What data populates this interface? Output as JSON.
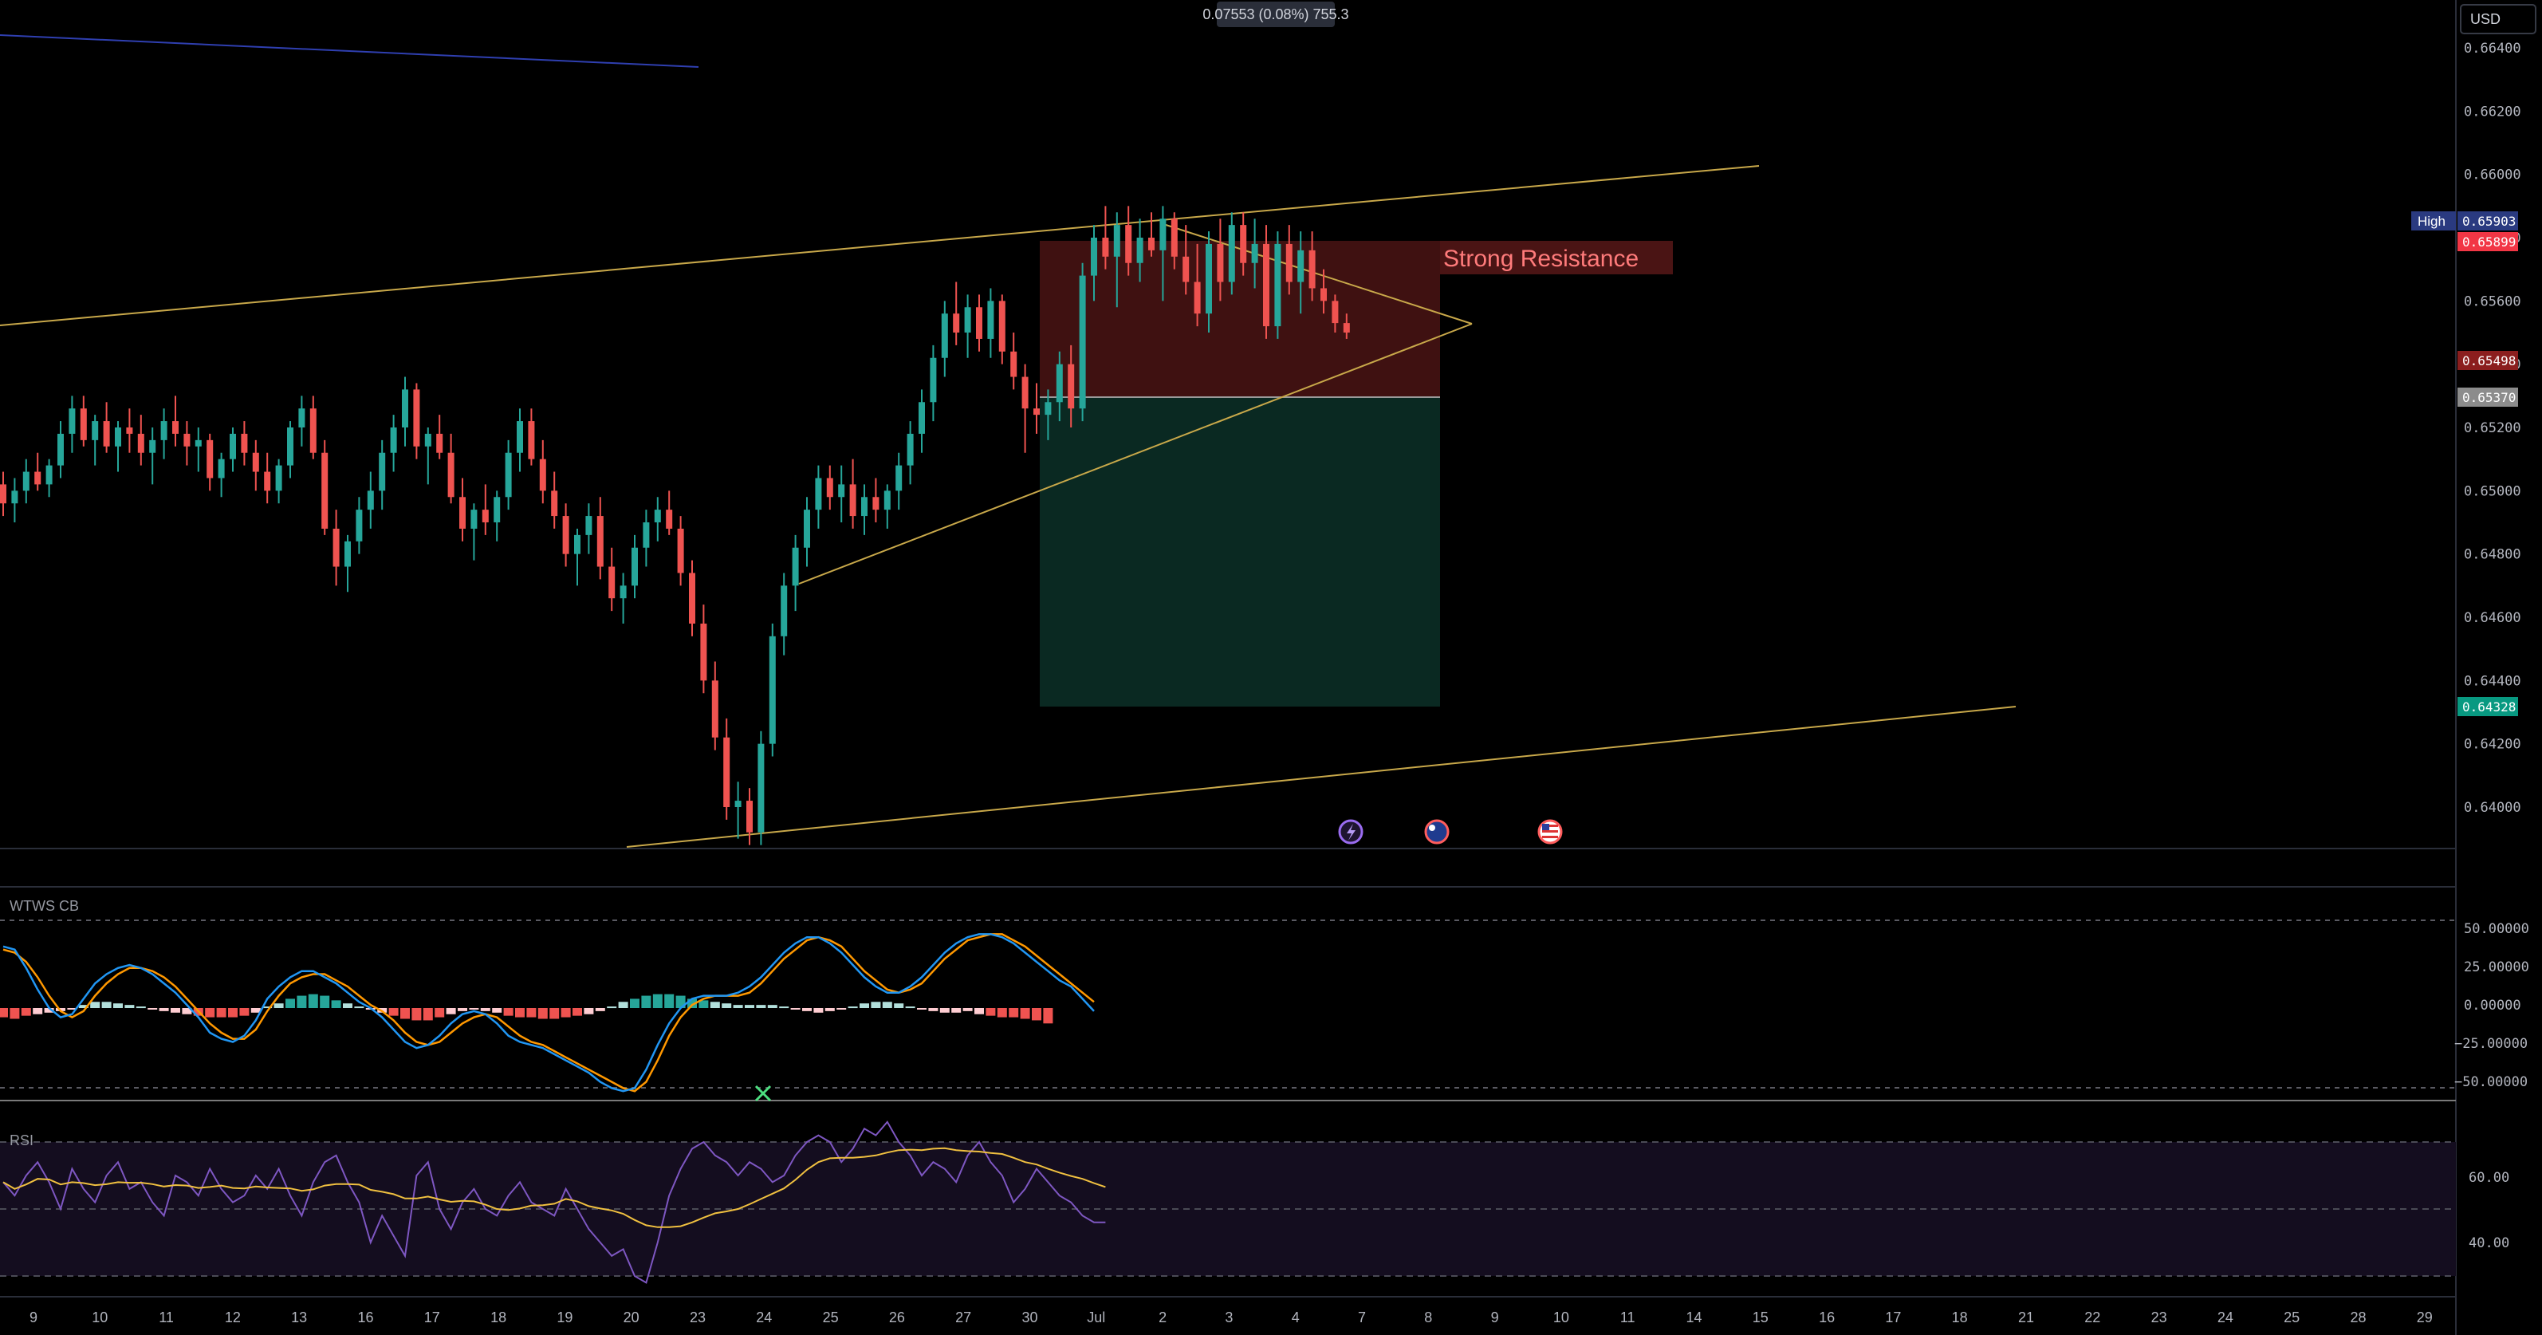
{
  "header": {
    "measure_label": "0.07553 (0.08%) 755.3"
  },
  "currency_button": "USD",
  "colors": {
    "bg": "#000000",
    "up": "#26a69a",
    "down": "#ef5350",
    "trendline": "#c8a84a",
    "blue_line": "#2f3fb0",
    "resistance_zone": "#5a1a1a",
    "target_zone": "#0b2e26",
    "wt1": "#2196f3",
    "wt2": "#ff9800",
    "rsi": "#7e57c2",
    "rsi_ma": "#f0c040",
    "high_badge": "#2a3a80",
    "price_badge": "#f23645",
    "stop_badge": "#8c8c8c",
    "target_badge": "#089981",
    "sell_badge": "#8b1e1e"
  },
  "price_axis": {
    "ticks": [
      "0.66400",
      "0.66200",
      "0.66000",
      "0.65800",
      "0.65600",
      "0.65400",
      "0.65200",
      "0.65000",
      "0.64800",
      "0.64600",
      "0.64400",
      "0.64200",
      "0.64000"
    ],
    "high_label": "High",
    "high_value": "0.65903",
    "current_price": "0.65899",
    "entry_price": "0.65498",
    "stop_price": "0.65370",
    "target_price": "0.64328"
  },
  "annotations": {
    "resistance_text": "Strong Resistance"
  },
  "event_icons": [
    "lightning-icon",
    "australia-flag-icon",
    "us-flag-icon"
  ],
  "wt_panel": {
    "title": "WTWS CB",
    "ticks": [
      "50.00000",
      "25.00000",
      "0.00000",
      "−25.00000",
      "−50.00000"
    ]
  },
  "rsi_panel": {
    "title": "RSI",
    "ticks": [
      "60.00",
      "40.00"
    ]
  },
  "time_axis": {
    "labels": [
      "9",
      "10",
      "11",
      "12",
      "13",
      "16",
      "17",
      "18",
      "19",
      "20",
      "23",
      "24",
      "25",
      "26",
      "27",
      "30",
      "Jul",
      "2",
      "3",
      "4",
      "7",
      "8",
      "9",
      "10",
      "11",
      "14",
      "15",
      "16",
      "17",
      "18",
      "21",
      "22",
      "23",
      "24",
      "25",
      "28",
      "29"
    ]
  },
  "chart_data": {
    "type": "candlestick",
    "price_scale": {
      "ylim": [
        0.6384,
        0.6668
      ]
    },
    "ohlc": [
      [
        0.6502,
        0.6506,
        0.6492,
        0.6496
      ],
      [
        0.6496,
        0.6504,
        0.649,
        0.65
      ],
      [
        0.65,
        0.651,
        0.6496,
        0.6506
      ],
      [
        0.6506,
        0.6512,
        0.65,
        0.6502
      ],
      [
        0.6502,
        0.651,
        0.6498,
        0.6508
      ],
      [
        0.6508,
        0.6522,
        0.6504,
        0.6518
      ],
      [
        0.6518,
        0.653,
        0.6512,
        0.6526
      ],
      [
        0.6526,
        0.653,
        0.6514,
        0.6516
      ],
      [
        0.6516,
        0.6524,
        0.6508,
        0.6522
      ],
      [
        0.6522,
        0.6528,
        0.6512,
        0.6514
      ],
      [
        0.6514,
        0.6522,
        0.6506,
        0.652
      ],
      [
        0.652,
        0.6526,
        0.6512,
        0.6518
      ],
      [
        0.6518,
        0.6524,
        0.6508,
        0.6512
      ],
      [
        0.6512,
        0.652,
        0.6502,
        0.6516
      ],
      [
        0.6516,
        0.6526,
        0.651,
        0.6522
      ],
      [
        0.6522,
        0.653,
        0.6514,
        0.6518
      ],
      [
        0.6518,
        0.6522,
        0.6508,
        0.6514
      ],
      [
        0.6514,
        0.652,
        0.6506,
        0.6516
      ],
      [
        0.6516,
        0.6518,
        0.65,
        0.6504
      ],
      [
        0.6504,
        0.6512,
        0.6498,
        0.651
      ],
      [
        0.651,
        0.652,
        0.6506,
        0.6518
      ],
      [
        0.6518,
        0.6522,
        0.6508,
        0.6512
      ],
      [
        0.6512,
        0.6516,
        0.65,
        0.6506
      ],
      [
        0.6506,
        0.6512,
        0.6496,
        0.65
      ],
      [
        0.65,
        0.651,
        0.6496,
        0.6508
      ],
      [
        0.6508,
        0.6522,
        0.6504,
        0.652
      ],
      [
        0.652,
        0.653,
        0.6514,
        0.6526
      ],
      [
        0.6526,
        0.653,
        0.651,
        0.6512
      ],
      [
        0.6512,
        0.6516,
        0.6486,
        0.6488
      ],
      [
        0.6488,
        0.6494,
        0.647,
        0.6476
      ],
      [
        0.6476,
        0.6486,
        0.6468,
        0.6484
      ],
      [
        0.6484,
        0.6498,
        0.648,
        0.6494
      ],
      [
        0.6494,
        0.6506,
        0.6488,
        0.65
      ],
      [
        0.65,
        0.6516,
        0.6494,
        0.6512
      ],
      [
        0.6512,
        0.6524,
        0.6506,
        0.652
      ],
      [
        0.652,
        0.6536,
        0.6514,
        0.6532
      ],
      [
        0.6532,
        0.6534,
        0.651,
        0.6514
      ],
      [
        0.6514,
        0.652,
        0.6502,
        0.6518
      ],
      [
        0.6518,
        0.6524,
        0.651,
        0.6512
      ],
      [
        0.6512,
        0.6518,
        0.6496,
        0.6498
      ],
      [
        0.6498,
        0.6504,
        0.6484,
        0.6488
      ],
      [
        0.6488,
        0.6496,
        0.6478,
        0.6494
      ],
      [
        0.6494,
        0.6502,
        0.6486,
        0.649
      ],
      [
        0.649,
        0.65,
        0.6484,
        0.6498
      ],
      [
        0.6498,
        0.6516,
        0.6494,
        0.6512
      ],
      [
        0.6512,
        0.6526,
        0.6506,
        0.6522
      ],
      [
        0.6522,
        0.6526,
        0.6508,
        0.651
      ],
      [
        0.651,
        0.6516,
        0.6496,
        0.65
      ],
      [
        0.65,
        0.6506,
        0.6488,
        0.6492
      ],
      [
        0.6492,
        0.6496,
        0.6476,
        0.648
      ],
      [
        0.648,
        0.6488,
        0.647,
        0.6486
      ],
      [
        0.6486,
        0.6496,
        0.648,
        0.6492
      ],
      [
        0.6492,
        0.6498,
        0.6472,
        0.6476
      ],
      [
        0.6476,
        0.6482,
        0.6462,
        0.6466
      ],
      [
        0.6466,
        0.6474,
        0.6458,
        0.647
      ],
      [
        0.647,
        0.6486,
        0.6466,
        0.6482
      ],
      [
        0.6482,
        0.6494,
        0.6476,
        0.649
      ],
      [
        0.649,
        0.6498,
        0.6484,
        0.6494
      ],
      [
        0.6494,
        0.65,
        0.6486,
        0.6488
      ],
      [
        0.6488,
        0.6492,
        0.647,
        0.6474
      ],
      [
        0.6474,
        0.6478,
        0.6454,
        0.6458
      ],
      [
        0.6458,
        0.6464,
        0.6436,
        0.644
      ],
      [
        0.644,
        0.6446,
        0.6418,
        0.6422
      ],
      [
        0.6422,
        0.6428,
        0.6396,
        0.64
      ],
      [
        0.64,
        0.6408,
        0.639,
        0.6402
      ],
      [
        0.6402,
        0.6406,
        0.6388,
        0.6392
      ],
      [
        0.6392,
        0.6424,
        0.6388,
        0.642
      ],
      [
        0.642,
        0.6458,
        0.6416,
        0.6454
      ],
      [
        0.6454,
        0.6474,
        0.6448,
        0.647
      ],
      [
        0.647,
        0.6486,
        0.6462,
        0.6482
      ],
      [
        0.6482,
        0.6498,
        0.6476,
        0.6494
      ],
      [
        0.6494,
        0.6508,
        0.6488,
        0.6504
      ],
      [
        0.6504,
        0.6508,
        0.6494,
        0.6498
      ],
      [
        0.6498,
        0.6508,
        0.649,
        0.6502
      ],
      [
        0.6502,
        0.651,
        0.6488,
        0.6492
      ],
      [
        0.6492,
        0.6502,
        0.6486,
        0.6498
      ],
      [
        0.6498,
        0.6504,
        0.649,
        0.6494
      ],
      [
        0.6494,
        0.6502,
        0.6488,
        0.65
      ],
      [
        0.65,
        0.6512,
        0.6494,
        0.6508
      ],
      [
        0.6508,
        0.6522,
        0.6502,
        0.6518
      ],
      [
        0.6518,
        0.6532,
        0.6512,
        0.6528
      ],
      [
        0.6528,
        0.6546,
        0.6522,
        0.6542
      ],
      [
        0.6542,
        0.656,
        0.6536,
        0.6556
      ],
      [
        0.6556,
        0.6566,
        0.6546,
        0.655
      ],
      [
        0.655,
        0.6562,
        0.6542,
        0.6558
      ],
      [
        0.6558,
        0.6562,
        0.6544,
        0.6548
      ],
      [
        0.6548,
        0.6564,
        0.6542,
        0.656
      ],
      [
        0.656,
        0.6562,
        0.654,
        0.6544
      ],
      [
        0.6544,
        0.655,
        0.6532,
        0.6536
      ],
      [
        0.6536,
        0.654,
        0.6512,
        0.6526
      ],
      [
        0.6526,
        0.6534,
        0.6518,
        0.6524
      ],
      [
        0.6524,
        0.6532,
        0.6516,
        0.6528
      ],
      [
        0.6528,
        0.6544,
        0.6522,
        0.654
      ],
      [
        0.654,
        0.6546,
        0.652,
        0.6526
      ],
      [
        0.6526,
        0.6572,
        0.6522,
        0.6568
      ],
      [
        0.6568,
        0.6584,
        0.656,
        0.658
      ],
      [
        0.658,
        0.659,
        0.657,
        0.6574
      ],
      [
        0.6574,
        0.6588,
        0.6558,
        0.6584
      ],
      [
        0.6584,
        0.659,
        0.6568,
        0.6572
      ],
      [
        0.6572,
        0.6586,
        0.6566,
        0.658
      ],
      [
        0.658,
        0.6588,
        0.6574,
        0.6576
      ],
      [
        0.6576,
        0.659,
        0.656,
        0.6586
      ],
      [
        0.6586,
        0.6588,
        0.657,
        0.6574
      ],
      [
        0.6574,
        0.6584,
        0.6562,
        0.6566
      ],
      [
        0.6566,
        0.6578,
        0.6552,
        0.6556
      ],
      [
        0.6556,
        0.6582,
        0.655,
        0.6578
      ],
      [
        0.6578,
        0.6586,
        0.656,
        0.6566
      ],
      [
        0.6566,
        0.6588,
        0.6562,
        0.6584
      ],
      [
        0.6584,
        0.6588,
        0.6568,
        0.6572
      ],
      [
        0.6572,
        0.6586,
        0.6564,
        0.6578
      ],
      [
        0.6578,
        0.6584,
        0.6548,
        0.6552
      ],
      [
        0.6552,
        0.6582,
        0.6548,
        0.6578
      ],
      [
        0.6578,
        0.6584,
        0.6562,
        0.6566
      ],
      [
        0.6566,
        0.6582,
        0.6556,
        0.6576
      ],
      [
        0.6576,
        0.6582,
        0.656,
        0.6564
      ],
      [
        0.6564,
        0.657,
        0.6556,
        0.656
      ],
      [
        0.656,
        0.6562,
        0.655,
        0.6553
      ],
      [
        0.6553,
        0.6556,
        0.6548,
        0.655
      ]
    ],
    "wt": {
      "wt1": [
        40,
        38,
        26,
        12,
        0,
        -6,
        -4,
        6,
        16,
        22,
        26,
        28,
        26,
        22,
        16,
        10,
        2,
        -6,
        -16,
        -20,
        -22,
        -18,
        -8,
        6,
        14,
        20,
        24,
        24,
        20,
        16,
        10,
        4,
        0,
        -6,
        -14,
        -22,
        -26,
        -24,
        -18,
        -10,
        -4,
        -2,
        -4,
        -10,
        -18,
        -22,
        -24,
        -26,
        -30,
        -34,
        -38,
        -42,
        -48,
        -52,
        -54,
        -52,
        -40,
        -24,
        -10,
        0,
        6,
        8,
        8,
        8,
        10,
        14,
        20,
        28,
        36,
        42,
        46,
        46,
        42,
        36,
        28,
        20,
        14,
        10,
        10,
        14,
        20,
        28,
        36,
        42,
        46,
        48,
        48,
        46,
        42,
        36,
        30,
        24,
        18,
        14,
        6,
        -2
      ],
      "wt2": [
        38,
        36,
        30,
        20,
        8,
        -2,
        -6,
        -2,
        8,
        16,
        22,
        26,
        26,
        24,
        20,
        14,
        6,
        -2,
        -10,
        -16,
        -20,
        -20,
        -14,
        -2,
        8,
        16,
        20,
        22,
        22,
        18,
        14,
        8,
        2,
        -2,
        -8,
        -16,
        -22,
        -24,
        -22,
        -16,
        -10,
        -6,
        -4,
        -6,
        -12,
        -18,
        -22,
        -24,
        -28,
        -32,
        -36,
        -40,
        -44,
        -48,
        -52,
        -54,
        -48,
        -34,
        -18,
        -6,
        2,
        6,
        8,
        8,
        8,
        10,
        16,
        24,
        32,
        38,
        44,
        46,
        44,
        40,
        32,
        24,
        18,
        12,
        10,
        12,
        16,
        24,
        32,
        38,
        44,
        46,
        48,
        48,
        44,
        40,
        34,
        28,
        22,
        16,
        10,
        4
      ],
      "hist": [
        -6,
        -7,
        -5,
        -4,
        -3,
        -2,
        -1,
        2,
        4,
        4,
        3,
        2,
        1,
        -1,
        -2,
        -3,
        -4,
        -5,
        -6,
        -6,
        -6,
        -5,
        -3,
        1,
        3,
        6,
        8,
        9,
        8,
        5,
        3,
        1,
        -1,
        -3,
        -5,
        -7,
        -8,
        -8,
        -6,
        -4,
        -2,
        -1,
        -2,
        -3,
        -5,
        -6,
        -6,
        -7,
        -7,
        -6,
        -5,
        -4,
        -2,
        1,
        4,
        6,
        8,
        9,
        9,
        8,
        6,
        5,
        4,
        3,
        2,
        2,
        2,
        2,
        1,
        -1,
        -2,
        -3,
        -2,
        -1,
        1,
        3,
        4,
        4,
        3,
        1,
        -1,
        -2,
        -3,
        -3,
        -2,
        -4,
        -5,
        -6,
        -6,
        -7,
        -8,
        -10
      ]
    },
    "rsi": {
      "rsi": [
        58,
        54,
        60,
        64,
        58,
        50,
        62,
        56,
        52,
        60,
        64,
        56,
        58,
        52,
        48,
        60,
        58,
        54,
        62,
        56,
        52,
        54,
        60,
        56,
        62,
        54,
        48,
        58,
        64,
        66,
        58,
        52,
        40,
        48,
        42,
        36,
        60,
        64,
        50,
        44,
        52,
        56,
        50,
        48,
        54,
        58,
        52,
        50,
        48,
        56,
        50,
        44,
        40,
        36,
        38,
        30,
        28,
        40,
        54,
        62,
        68,
        70,
        66,
        64,
        60,
        64,
        62,
        58,
        60,
        66,
        70,
        72,
        70,
        64,
        68,
        74,
        72,
        76,
        70,
        66,
        60,
        64,
        62,
        58,
        66,
        70,
        64,
        60,
        52,
        56,
        62,
        58,
        54,
        52,
        48,
        46,
        46
      ]
    },
    "x_labels": [
      "9",
      "10",
      "11",
      "12",
      "13",
      "16",
      "17",
      "18",
      "19",
      "20",
      "23",
      "24",
      "25",
      "26",
      "27",
      "30",
      "Jul",
      "2",
      "3",
      "4",
      "7",
      "8",
      "9",
      "10",
      "11",
      "14",
      "15",
      "16",
      "17",
      "18",
      "21",
      "22",
      "23",
      "24",
      "25",
      "28",
      "29"
    ]
  }
}
